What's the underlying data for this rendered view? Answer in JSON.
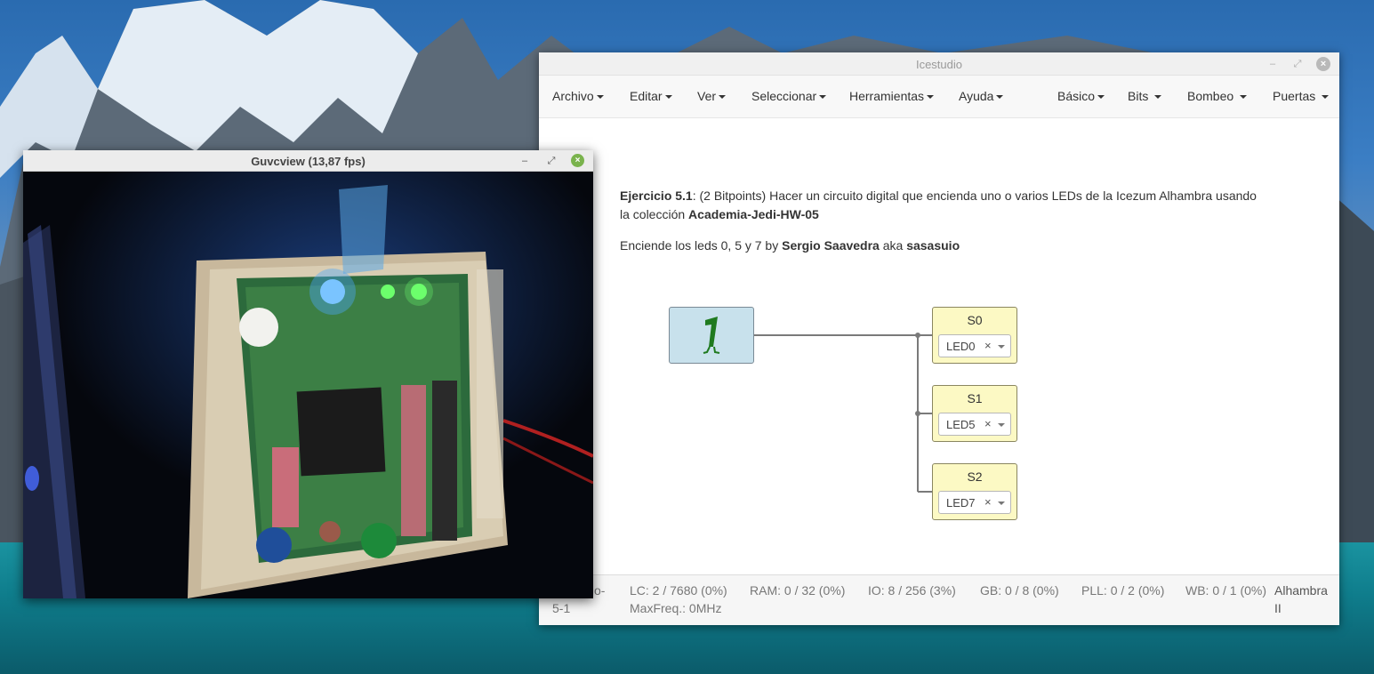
{
  "icestudio": {
    "title": "Icestudio",
    "menus": [
      {
        "label": "Archivo"
      },
      {
        "label": "Editar"
      },
      {
        "label": "Ver"
      },
      {
        "label": "Seleccionar"
      },
      {
        "label": "Herramientas"
      },
      {
        "label": "Ayuda"
      },
      {
        "label": "Básico"
      },
      {
        "label": "Bits"
      },
      {
        "label": "Bombeo"
      },
      {
        "label": "Puertas"
      }
    ],
    "description": {
      "line1_bold1": "Ejercicio 5.1",
      "line1_text": ": (2 Bitpoints) Hacer un circuito digital que encienda uno o varios LEDs de la Icezum Alhambra usando",
      "line2_text": "la colección ",
      "line2_bold": "Academia-Jedi-HW-05",
      "line3_text1": "Enciende los leds 0, 5 y 7 by ",
      "line3_bold1": "Sergio Saavedra",
      "line3_text2": " aka ",
      "line3_bold2": "sasasuio"
    },
    "constant_block": {
      "value": "1",
      "icon": "jedi-one-icon"
    },
    "leds": [
      {
        "name": "S0",
        "value": "LED0",
        "clear": "×"
      },
      {
        "name": "S1",
        "value": "LED5",
        "clear": "×"
      },
      {
        "name": "S2",
        "value": "LED7",
        "clear": "×"
      }
    ],
    "status": {
      "project_line1": "o-",
      "project_line2": "5-1",
      "lc": "LC:  2 / 7680 (0%)",
      "maxfreq": "MaxFreq.:  0MHz",
      "ram": "RAM:  0 / 32 (0%)",
      "io": "IO:  8 / 256 (3%)",
      "gb": "GB:  0 / 8 (0%)",
      "pll": "PLL:  0 / 2 (0%)",
      "wb": "WB:  0 / 1 (0%)",
      "board_line1": "Alhambra",
      "board_line2": "II"
    }
  },
  "guvcview": {
    "title": "Guvcview  (13,87 fps)",
    "close": "×"
  }
}
